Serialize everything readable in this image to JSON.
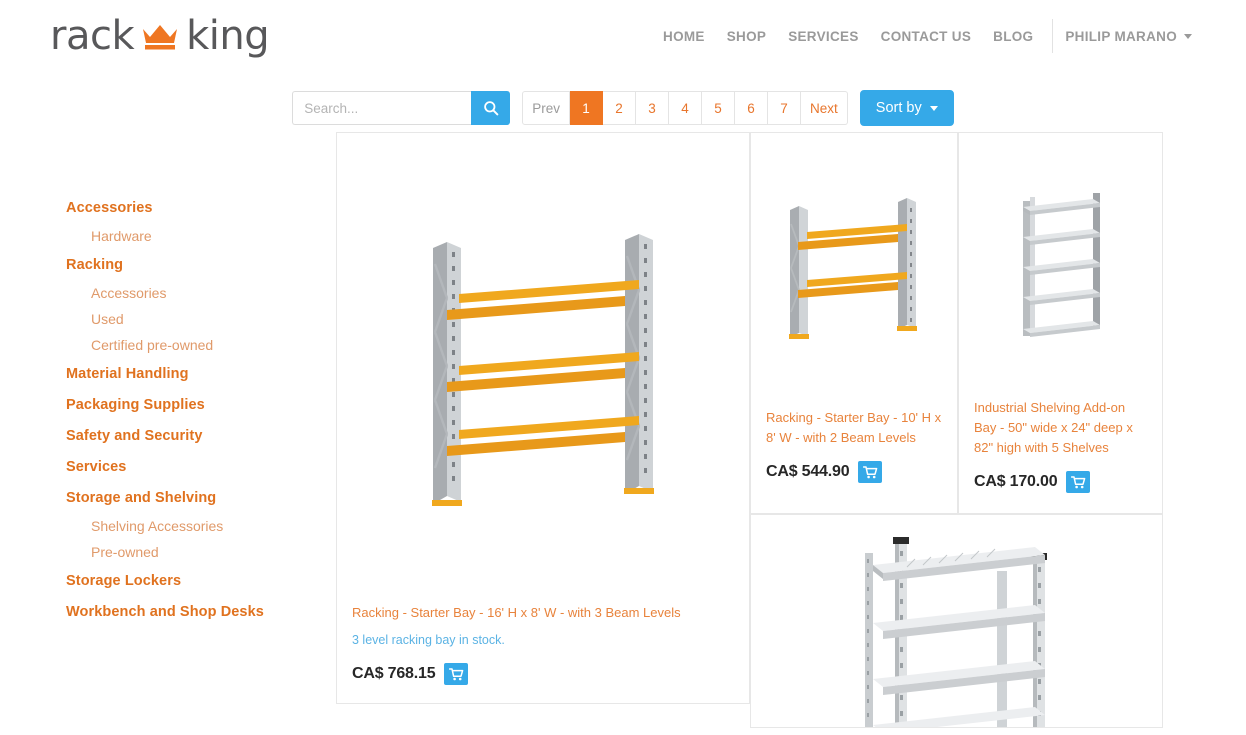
{
  "brand": {
    "word1": "rack",
    "word2": "king",
    "crown_color": "#ef7622",
    "text_color": "#58585a"
  },
  "nav": {
    "items": [
      {
        "label": "HOME"
      },
      {
        "label": "SHOP"
      },
      {
        "label": "SERVICES"
      },
      {
        "label": "CONTACT US"
      },
      {
        "label": "BLOG"
      }
    ],
    "user": "PHILIP MARANO"
  },
  "toolbar": {
    "search_placeholder": "Search...",
    "search_value": "",
    "search_icon": "search-icon",
    "pagination": [
      {
        "label": "Prev",
        "state": "muted"
      },
      {
        "label": "1",
        "state": "active"
      },
      {
        "label": "2",
        "state": "normal"
      },
      {
        "label": "3",
        "state": "normal"
      },
      {
        "label": "4",
        "state": "normal"
      },
      {
        "label": "5",
        "state": "normal"
      },
      {
        "label": "6",
        "state": "normal"
      },
      {
        "label": "7",
        "state": "normal"
      },
      {
        "label": "Next",
        "state": "normal"
      }
    ],
    "sort_label": "Sort by",
    "accent_blue": "#35a9e8",
    "accent_orange": "#ef7622"
  },
  "sidebar": {
    "categories": [
      {
        "label": "Accessories",
        "level": "top"
      },
      {
        "label": "Hardware",
        "level": "sub"
      },
      {
        "label": "Racking",
        "level": "top"
      },
      {
        "label": "Accessories",
        "level": "sub"
      },
      {
        "label": "Used",
        "level": "sub"
      },
      {
        "label": "Certified pre-owned",
        "level": "sub"
      },
      {
        "label": "Material Handling",
        "level": "top"
      },
      {
        "label": "Packaging Supplies",
        "level": "top"
      },
      {
        "label": "Safety and Security",
        "level": "top"
      },
      {
        "label": "Services",
        "level": "top"
      },
      {
        "label": "Storage and Shelving",
        "level": "top"
      },
      {
        "label": "Shelving Accessories",
        "level": "sub"
      },
      {
        "label": "Pre-owned",
        "level": "sub"
      },
      {
        "label": "Storage Lockers",
        "level": "top"
      },
      {
        "label": "Workbench and Shop Desks",
        "level": "top"
      }
    ]
  },
  "products": [
    {
      "title": "Racking - Starter Bay - 16' H x 8' W - with 3 Beam Levels",
      "description": "3 level racking bay in stock.",
      "price": "CA$ 768.15",
      "image": "pallet-racking-3-levels",
      "cart_icon": "cart-icon"
    },
    {
      "title": "Racking - Starter Bay - 10' H x 8' W - with 2 Beam Levels",
      "description": "",
      "price": "CA$ 544.90",
      "image": "pallet-racking-2-levels",
      "cart_icon": "cart-icon"
    },
    {
      "title": "Industrial Shelving Add-on Bay - 50\" wide x 24\" deep x 82\" high with 5 Shelves",
      "description": "",
      "price": "CA$ 170.00",
      "image": "industrial-shelving-5-shelves",
      "cart_icon": "cart-icon"
    },
    {
      "title": "",
      "description": "",
      "price": "",
      "image": "galvanized-shelving-unit",
      "cart_icon": "cart-icon"
    }
  ]
}
